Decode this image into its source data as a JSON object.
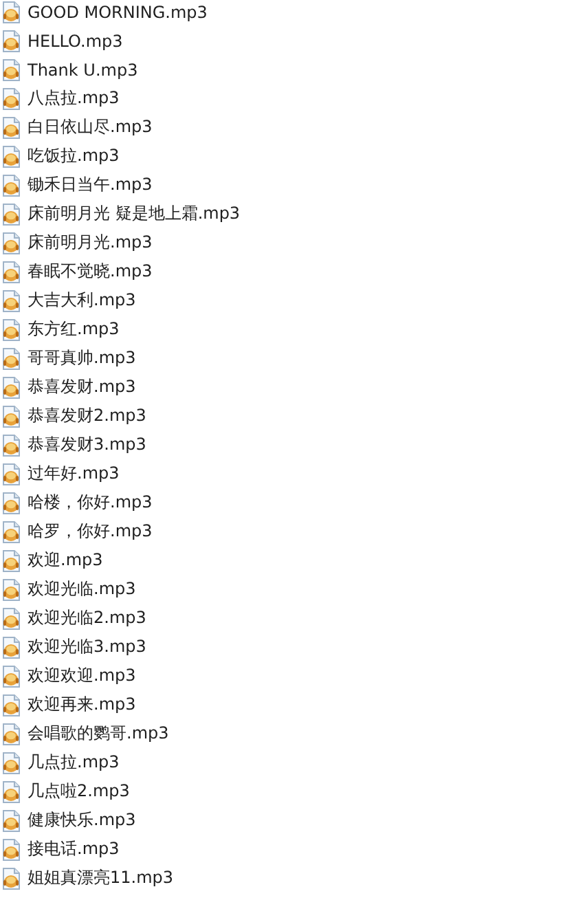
{
  "files": [
    {
      "name": "GOOD MORNING.mp3"
    },
    {
      "name": "HELLO.mp3"
    },
    {
      "name": "Thank U.mp3"
    },
    {
      "name": "八点拉.mp3"
    },
    {
      "name": "白日依山尽.mp3"
    },
    {
      "name": "吃饭拉.mp3"
    },
    {
      "name": "锄禾日当午.mp3"
    },
    {
      "name": "床前明月光 疑是地上霜.mp3"
    },
    {
      "name": "床前明月光.mp3"
    },
    {
      "name": "春眠不觉晓.mp3"
    },
    {
      "name": "大吉大利.mp3"
    },
    {
      "name": "东方红.mp3"
    },
    {
      "name": "哥哥真帅.mp3"
    },
    {
      "name": "恭喜发财.mp3"
    },
    {
      "name": "恭喜发财2.mp3"
    },
    {
      "name": "恭喜发财3.mp3"
    },
    {
      "name": "过年好.mp3"
    },
    {
      "name": "哈楼，你好.mp3"
    },
    {
      "name": "哈罗，你好.mp3"
    },
    {
      "name": "欢迎.mp3"
    },
    {
      "name": "欢迎光临.mp3"
    },
    {
      "name": "欢迎光临2.mp3"
    },
    {
      "name": "欢迎光临3.mp3"
    },
    {
      "name": "欢迎欢迎.mp3"
    },
    {
      "name": "欢迎再来.mp3"
    },
    {
      "name": "会唱歌的鹦哥.mp3"
    },
    {
      "name": "几点拉.mp3"
    },
    {
      "name": "几点啦2.mp3"
    },
    {
      "name": "健康快乐.mp3"
    },
    {
      "name": "接电话.mp3"
    },
    {
      "name": "姐姐真漂亮11.mp3"
    }
  ]
}
